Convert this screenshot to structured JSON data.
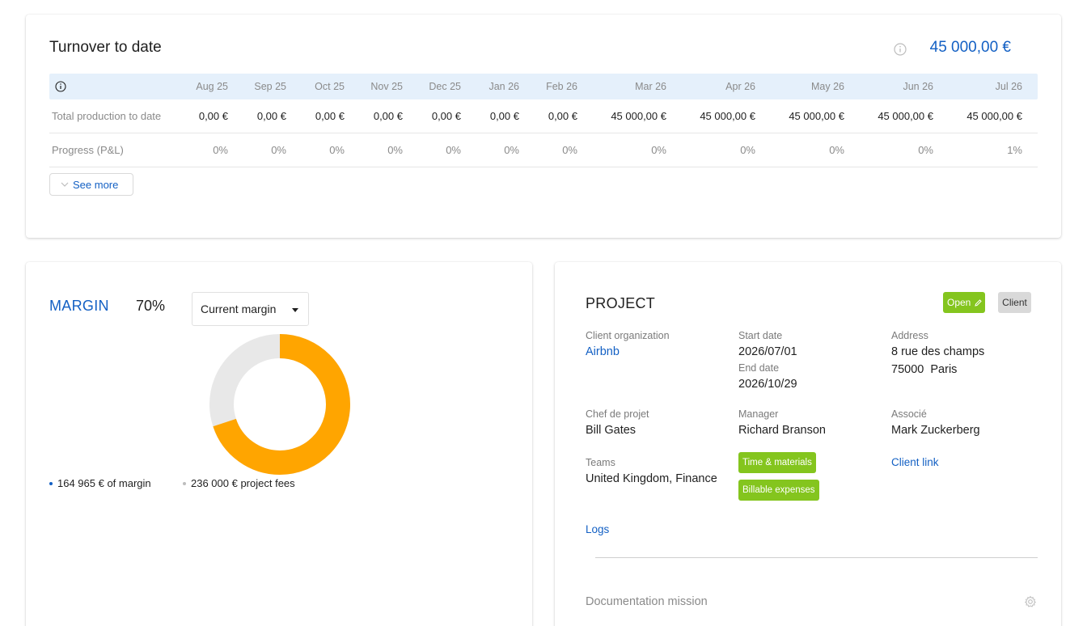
{
  "turnover": {
    "title": "Turnover to date",
    "total": "45 000,00 €",
    "months": [
      "Aug 25",
      "Sep 25",
      "Oct 25",
      "Nov 25",
      "Dec 25",
      "Jan 26",
      "Feb 26",
      "Mar 26",
      "Apr 26",
      "May 26",
      "Jun 26",
      "Jul 26"
    ],
    "rows": [
      {
        "label": "Total production to date",
        "values": [
          "0,00 €",
          "0,00 €",
          "0,00 €",
          "0,00 €",
          "0,00 €",
          "0,00 €",
          "0,00 €",
          "45 000,00 €",
          "45 000,00 €",
          "45 000,00 €",
          "45 000,00 €",
          "45 000,00 €"
        ]
      },
      {
        "label": "Progress (P&L)",
        "values": [
          "0%",
          "0%",
          "0%",
          "0%",
          "0%",
          "0%",
          "0%",
          "0%",
          "0%",
          "0%",
          "0%",
          "1%"
        ]
      }
    ],
    "see_more": "See more"
  },
  "margin": {
    "title": "MARGIN",
    "percent": "70%",
    "select_value": "Current margin",
    "legend": [
      {
        "text": "164 965 € of margin",
        "color": "#1360c4"
      },
      {
        "text": "236 000 € project fees",
        "color": "#bdbdbd"
      }
    ],
    "colors": {
      "margin": "#ffa500",
      "rest": "#e8e8e8"
    }
  },
  "chart_data": {
    "type": "pie",
    "categories": [
      "margin",
      "project fees"
    ],
    "values": [
      164965,
      236000
    ],
    "title": "MARGIN"
  },
  "project": {
    "title": "PROJECT",
    "status_badge": "Open",
    "type_badge": "Client",
    "client_org_label": "Client organization",
    "client_org_value": "Airbnb",
    "start_label": "Start date",
    "start_value": "2026/07/01",
    "end_label": "End date",
    "end_value": "2026/10/29",
    "address_label": "Address",
    "address_line1": "8 rue des champs",
    "address_line2": "75000  Paris",
    "chef_label": "Chef de projet",
    "chef_value": "Bill Gates",
    "manager_label": "Manager",
    "manager_value": "Richard Branson",
    "associe_label": "Associé",
    "associe_value": "Mark Zuckerberg",
    "teams_label": "Teams",
    "teams_value": "United Kingdom, Finance",
    "tags": [
      "Time & materials",
      "Billable expenses"
    ],
    "client_link": "Client link",
    "logs": "Logs",
    "documentation": "Documentation mission"
  }
}
